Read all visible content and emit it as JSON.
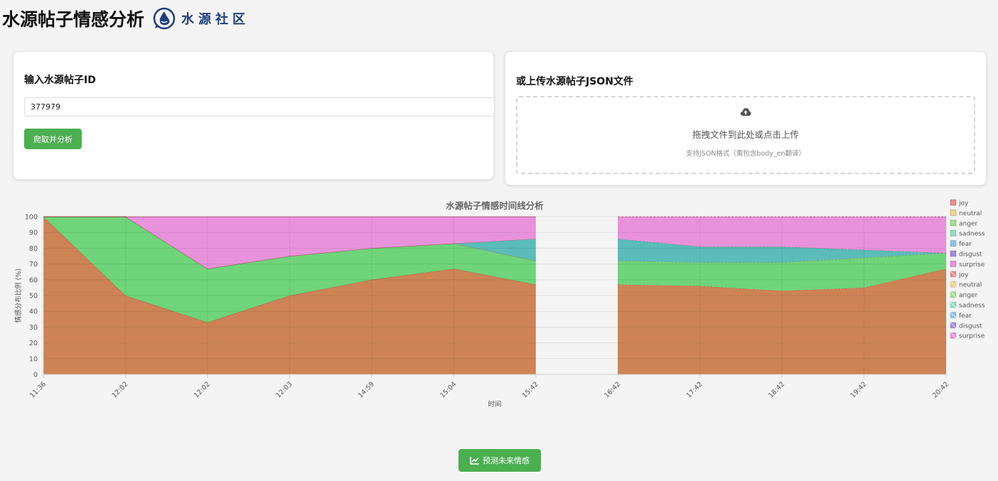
{
  "header": {
    "title": "水源帖子情感分析",
    "logo_text": "水源社区"
  },
  "id_panel": {
    "title": "输入水源帖子ID",
    "input_value": "377979",
    "button_label": "爬取并分析"
  },
  "upload_panel": {
    "title": "或上传水源帖子JSON文件",
    "drop_text": "拖拽文件到此处或点击上传",
    "hint_text": "支持JSON格式（需包含body_en翻译）"
  },
  "predict_button": {
    "label": "预测未来情感"
  },
  "colors": {
    "accent_green": "#4caf50",
    "joy": "#cd8356",
    "anger": "#6fd47a",
    "fear": "#5bbcba",
    "surprise": "#e892dc"
  },
  "chart_data": {
    "type": "area",
    "stacked": true,
    "title": "水源帖子情感时间线分析",
    "xlabel": "时间",
    "ylabel": "情感分布比例 (%)",
    "ylim": [
      0,
      100
    ],
    "yticks": [
      0,
      10,
      20,
      30,
      40,
      50,
      60,
      70,
      80,
      90,
      100
    ],
    "grid": true,
    "legend_position": "right",
    "categories": [
      "11:36",
      "12:02",
      "12:02",
      "12:03",
      "14:59",
      "15:04",
      "15:42",
      "16:42",
      "17:42",
      "18:42",
      "19:42",
      "20:42"
    ],
    "legend": [
      {
        "label": "joy",
        "color": "#ec8c8c",
        "style": "solid"
      },
      {
        "label": "neutral",
        "color": "#f2d48b",
        "style": "solid"
      },
      {
        "label": "anger",
        "color": "#a6e08a",
        "style": "solid"
      },
      {
        "label": "sadness",
        "color": "#8ee2c0",
        "style": "solid"
      },
      {
        "label": "fear",
        "color": "#8ec3ee",
        "style": "solid"
      },
      {
        "label": "disgust",
        "color": "#a78ae6",
        "style": "solid"
      },
      {
        "label": "surprise",
        "color": "#ee8ee0",
        "style": "solid"
      },
      {
        "label": "joy",
        "color": "#ec8c8c",
        "style": "dashed"
      },
      {
        "label": "neutral",
        "color": "#f2d48b",
        "style": "dashed"
      },
      {
        "label": "anger",
        "color": "#a6e08a",
        "style": "dashed"
      },
      {
        "label": "sadness",
        "color": "#8ee2c0",
        "style": "dashed"
      },
      {
        "label": "fear",
        "color": "#8ec3ee",
        "style": "dashed"
      },
      {
        "label": "disgust",
        "color": "#a78ae6",
        "style": "dashed"
      },
      {
        "label": "surprise",
        "color": "#ee8ee0",
        "style": "dashed"
      }
    ],
    "gap_between": [
      "15:42",
      "16:42"
    ],
    "historical": {
      "x_index": [
        0,
        1,
        2,
        3,
        4,
        5,
        6
      ],
      "series": [
        {
          "name": "joy",
          "values": [
            100,
            50,
            33,
            50,
            60,
            67,
            57
          ]
        },
        {
          "name": "anger",
          "values": [
            0,
            50,
            34,
            25,
            20,
            16,
            15
          ]
        },
        {
          "name": "fear",
          "values": [
            0,
            0,
            0,
            0,
            0,
            0,
            14
          ]
        },
        {
          "name": "surprise",
          "values": [
            0,
            0,
            33,
            25,
            20,
            17,
            14
          ]
        }
      ]
    },
    "predicted": {
      "x_index": [
        7,
        8,
        9,
        10,
        11
      ],
      "series": [
        {
          "name": "joy",
          "values": [
            57,
            56,
            53,
            55,
            67
          ]
        },
        {
          "name": "anger",
          "values": [
            15,
            15,
            18,
            19,
            10
          ]
        },
        {
          "name": "fear",
          "values": [
            14,
            10,
            10,
            5,
            0
          ]
        },
        {
          "name": "surprise",
          "values": [
            14,
            19,
            19,
            21,
            23
          ]
        }
      ]
    }
  }
}
